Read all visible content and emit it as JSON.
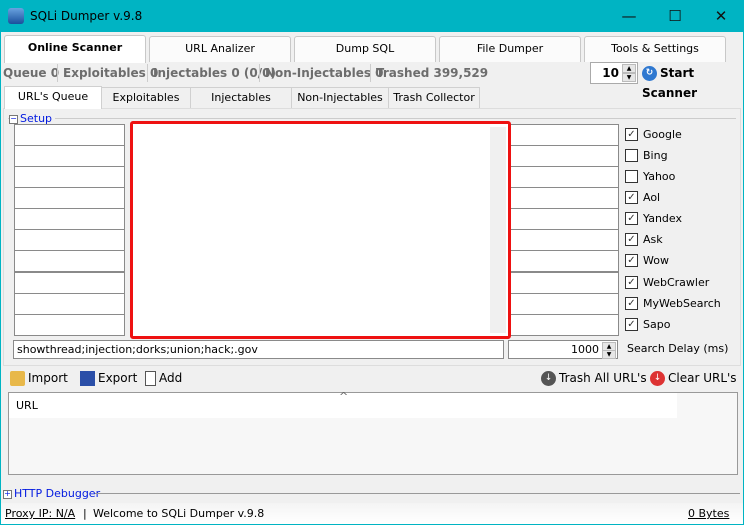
{
  "window": {
    "title": "SQLi Dumper v.9.8",
    "minimize": "—",
    "maximize": "☐",
    "close": "✕"
  },
  "main_tabs": [
    "Online Scanner",
    "URL Analizer",
    "Dump SQL",
    "File Dumper",
    "Tools & Settings"
  ],
  "stats": {
    "queue": "Queue 0",
    "exploitables": "Exploitables 0",
    "injectables": "Injectables 0 (0/0)",
    "non_injectables": "Non-Injectables 0",
    "trashed": "Trashed 399,529"
  },
  "threads": "10",
  "start_scanner": "Start Scanner",
  "sub_tabs": [
    "URL's Queue",
    "Exploitables",
    "Injectables",
    "Non-Injectables",
    "Trash Collector"
  ],
  "setup": {
    "label": "Setup",
    "engines": [
      {
        "label": "Google",
        "checked": true
      },
      {
        "label": "Bing",
        "checked": false
      },
      {
        "label": "Yahoo",
        "checked": false
      },
      {
        "label": "Aol",
        "checked": true
      },
      {
        "label": "Yandex",
        "checked": true
      },
      {
        "label": "Ask",
        "checked": true
      },
      {
        "label": "Wow",
        "checked": true
      },
      {
        "label": "WebCrawler",
        "checked": true
      },
      {
        "label": "MyWebSearch",
        "checked": true
      },
      {
        "label": "Sapo",
        "checked": true
      }
    ],
    "dorks_value": "showthread;injection;dorks;union;hack;.gov",
    "delay_value": "1000",
    "delay_label": "Search Delay (ms)"
  },
  "toolbar": {
    "import": "Import",
    "export": "Export",
    "add": "Add",
    "trash_all": "Trash All URL's",
    "clear": "Clear URL's"
  },
  "list": {
    "column": "URL",
    "sort": "^"
  },
  "http_debugger": "HTTP Debugger",
  "status": {
    "proxy": "Proxy IP: N/A",
    "message": "Welcome to SQLi Dumper v.9.8",
    "bytes": "0 Bytes"
  },
  "colors": {
    "titlebar": "#00b4c3",
    "highlight": "#ee1111",
    "link": "#0018e0"
  }
}
